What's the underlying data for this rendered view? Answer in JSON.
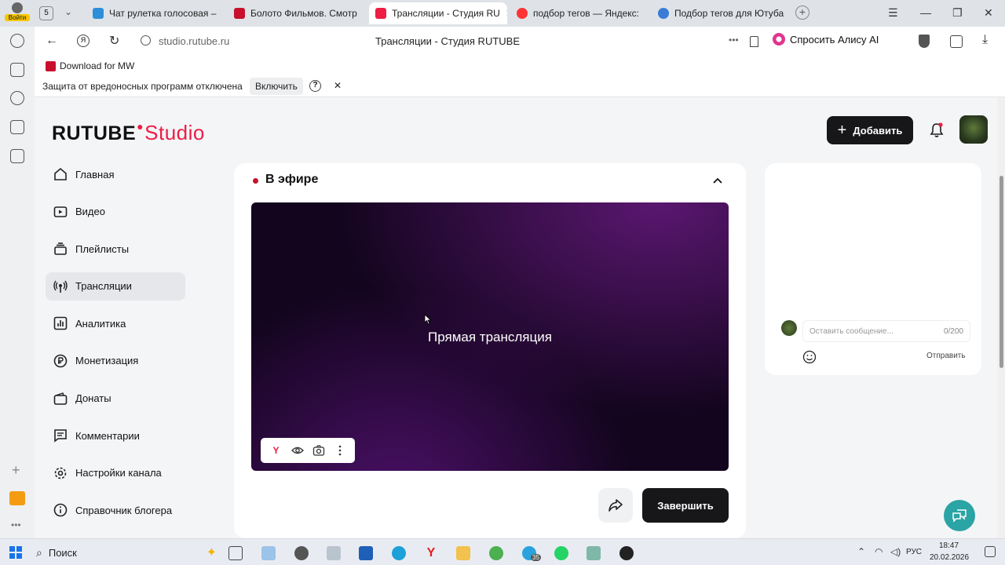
{
  "browser": {
    "profile_label": "Войти",
    "tab_counter": "5",
    "tabs": [
      {
        "title": "Чат рулетка голосовая –",
        "favicon_color": "#2d8fd8"
      },
      {
        "title": "Болото Фильмов. Смотр",
        "favicon_color": "#c8102e"
      },
      {
        "title": "Трансляции - Студия RU",
        "favicon_color": "#ed1d44"
      },
      {
        "title": "подбор тегов — Яндекс:",
        "favicon_color": "#f33"
      },
      {
        "title": "Подбор тегов для Ютуба",
        "favicon_color": "#3a7bd5"
      }
    ],
    "address": "studio.rutube.ru",
    "page_title": "Трансляции - Студия RUTUBE",
    "alice_button": "Спросить Алису AI",
    "bookmark": "Download for MW",
    "warning_text": "Защита от вредоносных программ отключена",
    "warning_enable": "Включить",
    "warning_help": "?"
  },
  "header": {
    "logo_main": "RUTUBE",
    "logo_studio": "Studio",
    "add_button": "Добавить"
  },
  "nav": {
    "items": [
      {
        "label": "Главная",
        "icon": "home-icon"
      },
      {
        "label": "Видео",
        "icon": "video-icon"
      },
      {
        "label": "Плейлисты",
        "icon": "playlist-icon"
      },
      {
        "label": "Трансляции",
        "icon": "broadcast-icon"
      },
      {
        "label": "Аналитика",
        "icon": "analytics-icon"
      },
      {
        "label": "Монетизация",
        "icon": "ruble-icon"
      },
      {
        "label": "Донаты",
        "icon": "wallet-icon"
      },
      {
        "label": "Комментарии",
        "icon": "comment-icon"
      },
      {
        "label": "Настройки канала",
        "icon": "gear-icon"
      },
      {
        "label": "Справочник блогера",
        "icon": "info-icon"
      }
    ]
  },
  "live": {
    "status": "В эфире",
    "player_text": "Прямая трансляция",
    "end_button": "Завершить"
  },
  "chat": {
    "placeholder": "Оставить сообщение...",
    "counter": "0/200",
    "send": "Отправить"
  },
  "taskbar": {
    "search": "Поиск",
    "lang": "РУС",
    "time": "18:47",
    "date": "20.02.2026",
    "badge": "35"
  },
  "colors": {
    "accent": "#ed1d44",
    "dark_button": "#17171a",
    "fab": "#2aa4a4"
  }
}
